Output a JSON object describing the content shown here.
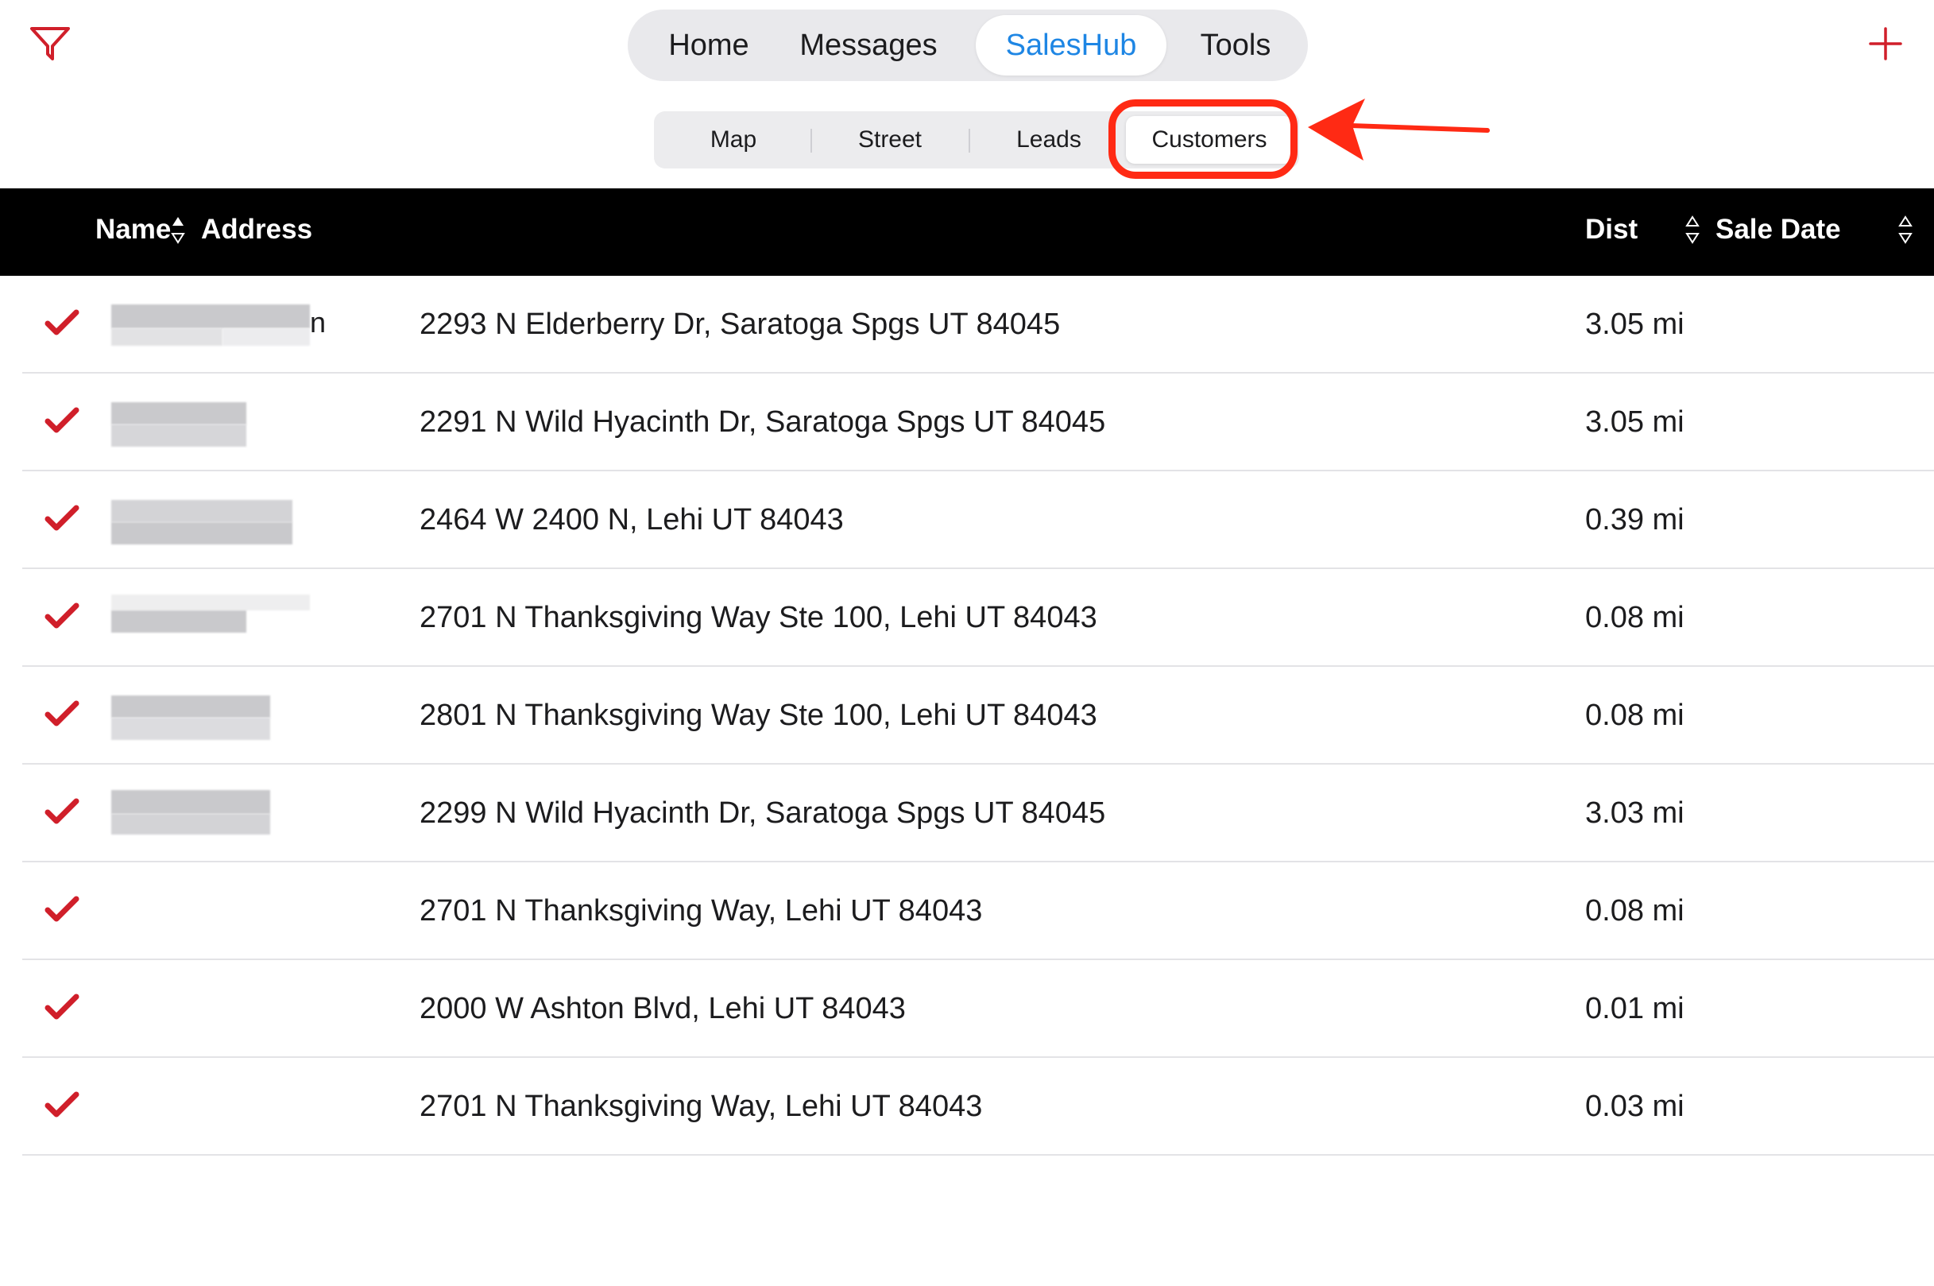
{
  "toolbar": {
    "filter_icon": "filter-icon",
    "add_icon": "plus-icon",
    "accent_color": "#d01f2a"
  },
  "main_tabs": [
    {
      "label": "Home",
      "active": false
    },
    {
      "label": "Messages",
      "active": false
    },
    {
      "label": "SalesHub",
      "active": true
    },
    {
      "label": "Tools",
      "active": false
    }
  ],
  "sub_tabs": [
    {
      "label": "Map",
      "active": false
    },
    {
      "label": "Street",
      "active": false
    },
    {
      "label": "Leads",
      "active": false
    },
    {
      "label": "Customers",
      "active": true
    }
  ],
  "annotation": {
    "highlight_color": "#ff2a14"
  },
  "table": {
    "headers": {
      "name": "Name",
      "address": "Address",
      "dist": "Dist",
      "sale_date": "Sale Date"
    },
    "rows": [
      {
        "name_tail": "n",
        "address": "2293 N Elderberry Dr, Saratoga Spgs UT 84045",
        "dist": "3.05 mi"
      },
      {
        "name_tail": "",
        "address": "2291 N Wild Hyacinth Dr, Saratoga Spgs UT 84045",
        "dist": "3.05 mi"
      },
      {
        "name_tail": "",
        "address": "2464 W 2400 N, Lehi UT 84043",
        "dist": "0.39 mi"
      },
      {
        "name_tail": "",
        "address": "2701 N Thanksgiving Way Ste 100, Lehi UT 84043",
        "dist": "0.08 mi"
      },
      {
        "name_tail": "",
        "address": "2801 N Thanksgiving Way Ste 100, Lehi UT 84043",
        "dist": "0.08 mi"
      },
      {
        "name_tail": "",
        "address": "2299 N Wild Hyacinth Dr, Saratoga Spgs UT 84045",
        "dist": "3.03 mi"
      },
      {
        "name_tail": "",
        "address": "2701 N Thanksgiving Way, Lehi UT 84043",
        "dist": "0.08 mi"
      },
      {
        "name_tail": "",
        "address": "2000 W Ashton Blvd, Lehi UT 84043",
        "dist": "0.01 mi"
      },
      {
        "name_tail": "",
        "address": "2701 N Thanksgiving Way, Lehi UT 84043",
        "dist": "0.03 mi"
      }
    ]
  }
}
